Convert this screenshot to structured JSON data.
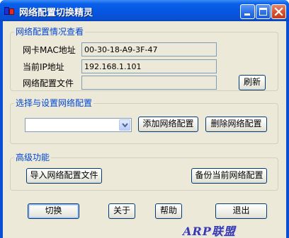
{
  "window": {
    "title": "网络配置切换精灵"
  },
  "status_group": {
    "title": "网络配置情况查看",
    "mac_label": "网卡MAC地址",
    "mac_value": "00-30-18-A9-3F-47",
    "ip_label": "当前IP地址",
    "ip_value": "192.168.1.101",
    "file_label": "网络配置文件",
    "file_value": "",
    "refresh_label": "刷新"
  },
  "select_group": {
    "title": "选择与设置网络配置",
    "combo_value": "",
    "add_label": "添加网络配置",
    "delete_label": "删除网络配置"
  },
  "advanced_group": {
    "title": "高级功能",
    "import_label": "导入网络配置文件",
    "backup_label": "备份当前网络配置"
  },
  "footer": {
    "switch_label": "切换",
    "about_label": "关于",
    "help_label": "帮助",
    "exit_label": "退出"
  },
  "watermark": {
    "text": "ARP联盟"
  },
  "colors": {
    "titlebar": "#0a5fe8",
    "group_title": "#0046d5",
    "dialog_bg": "#ece9d8",
    "close_button": "#d6502b"
  },
  "icons": {
    "app": "app-icon",
    "minimize": "minimize-icon",
    "maximize": "maximize-icon",
    "close": "close-icon",
    "dropdown": "chevron-down-icon"
  }
}
